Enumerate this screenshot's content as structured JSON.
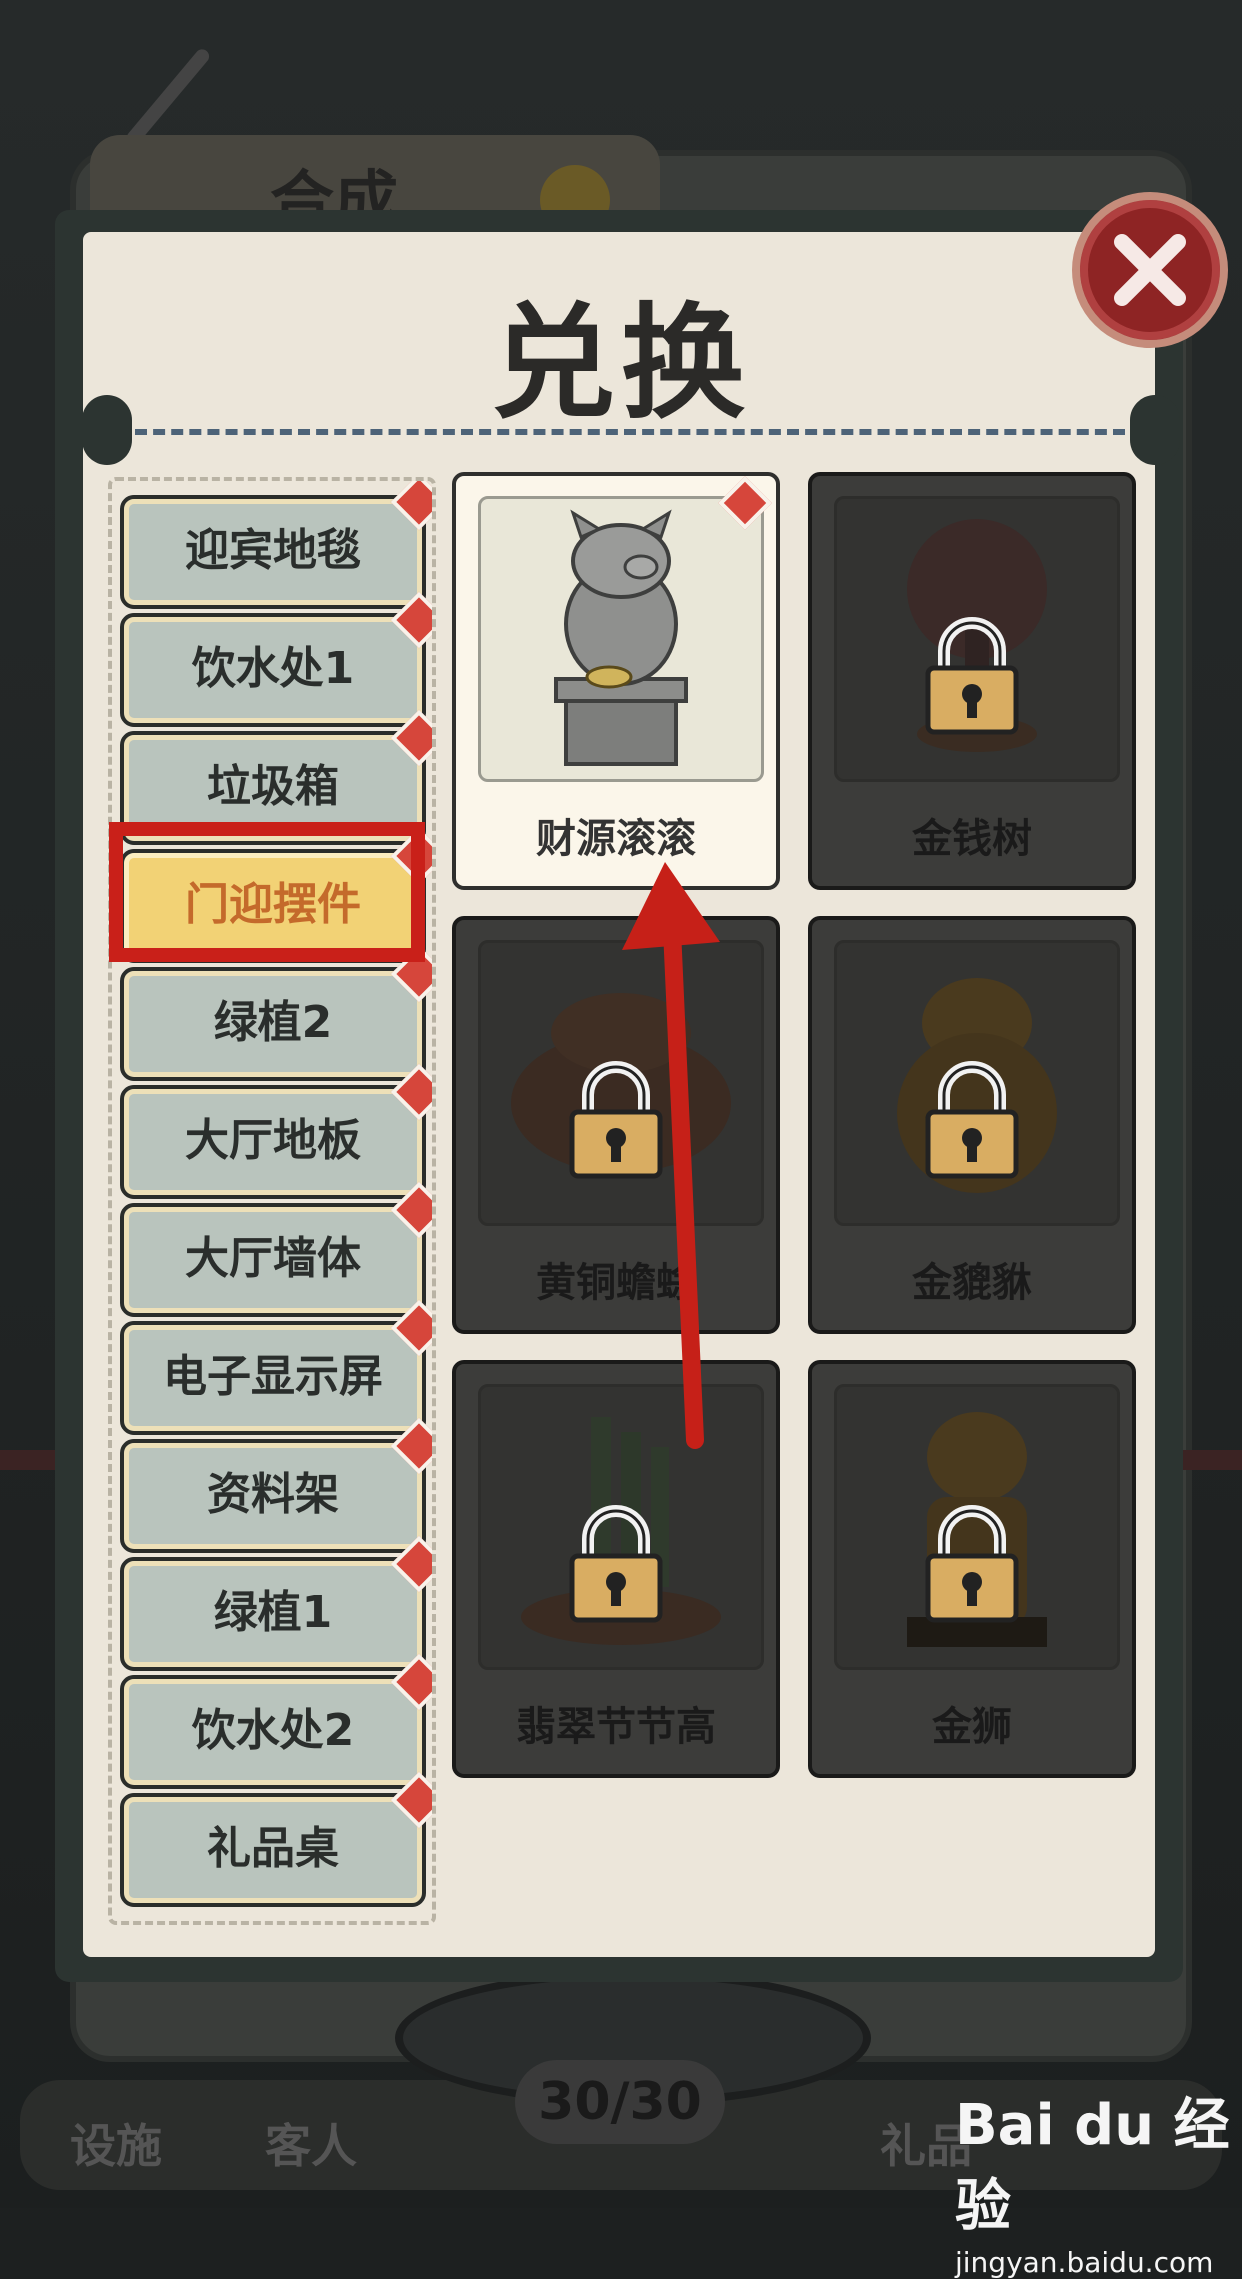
{
  "background": {
    "header_title": "合成",
    "counter": "30/30",
    "bottom_tabs": [
      "设施",
      "客人",
      "",
      "",
      "礼品"
    ]
  },
  "dialog": {
    "title": "兑换",
    "close_icon": "close-x-icon"
  },
  "categories": [
    {
      "label": "迎宾地毯",
      "selected": false,
      "badge": true
    },
    {
      "label": "饮水处1",
      "selected": false,
      "badge": true
    },
    {
      "label": "垃圾箱",
      "selected": false,
      "badge": true
    },
    {
      "label": "门迎摆件",
      "selected": true,
      "badge": true
    },
    {
      "label": "绿植2",
      "selected": false,
      "badge": true
    },
    {
      "label": "大厅地板",
      "selected": false,
      "badge": true
    },
    {
      "label": "大厅墙体",
      "selected": false,
      "badge": true
    },
    {
      "label": "电子显示屏",
      "selected": false,
      "badge": true
    },
    {
      "label": "资料架",
      "selected": false,
      "badge": true
    },
    {
      "label": "绿植1",
      "selected": false,
      "badge": true
    },
    {
      "label": "饮水处2",
      "selected": false,
      "badge": true
    },
    {
      "label": "礼品桌",
      "selected": false,
      "badge": true
    }
  ],
  "items": [
    {
      "name": "财源滚滚",
      "locked": false,
      "badge": true,
      "icon": "pig-statue-icon"
    },
    {
      "name": "金钱树",
      "locked": true,
      "badge": false,
      "icon": "money-tree-icon"
    },
    {
      "name": "黄铜蟾蜍",
      "locked": true,
      "badge": false,
      "icon": "brass-toad-icon"
    },
    {
      "name": "金貔貅",
      "locked": true,
      "badge": false,
      "icon": "golden-pixiu-icon"
    },
    {
      "name": "翡翠节节高",
      "locked": true,
      "badge": false,
      "icon": "jade-bamboo-icon"
    },
    {
      "name": "金狮",
      "locked": true,
      "badge": false,
      "icon": "golden-lion-icon"
    }
  ],
  "watermark": {
    "logo": "Bai du 经验",
    "url": "jingyan.baidu.com"
  },
  "colors": {
    "highlight": "#c92019",
    "selected_category": "#f2d275",
    "badge": "#d6463b"
  }
}
